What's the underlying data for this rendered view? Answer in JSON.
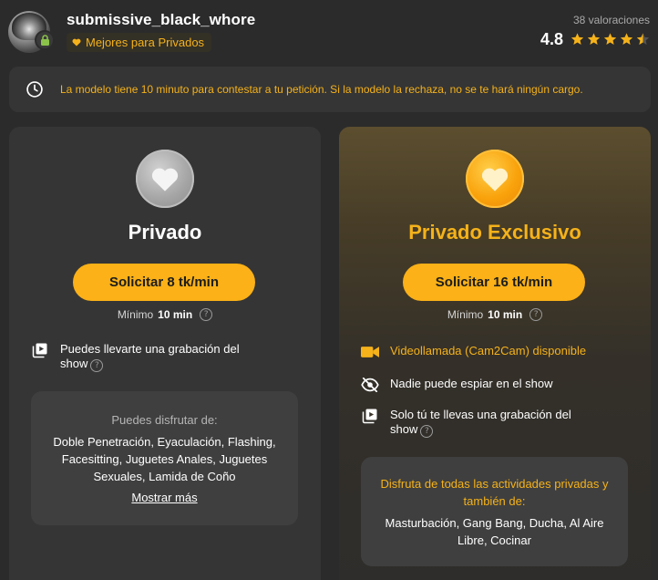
{
  "header": {
    "username": "submissive_black_whore",
    "tag_label": "Mejores para Privados",
    "rating_count": "38 valoraciones",
    "rating_value": "4.8",
    "stars_filled": 4.5
  },
  "notice": {
    "text": "La modelo tiene 10 minuto para contestar a tu petición. Si la modelo la rechaza, no se te hará ningún cargo."
  },
  "private": {
    "title": "Privado",
    "button_label": "Solicitar 8 tk/min",
    "minimo_label": "Mínimo",
    "minimo_value": "10 min",
    "feature_recording": "Puedes llevarte una grabación del show",
    "enjoy_title": "Puedes disfrutar de:",
    "enjoy_list": "Doble Penetración, Eyaculación, Flashing, Facesitting, Juguetes Anales, Juguetes Sexuales, Lamida de Coño",
    "show_more": "Mostrar más"
  },
  "exclusive": {
    "title": "Privado Exclusivo",
    "button_label": "Solicitar 16 tk/min",
    "minimo_label": "Mínimo",
    "minimo_value": "10 min",
    "feature_cam2cam": "Videollamada (Cam2Cam) disponible",
    "feature_nospy": "Nadie puede espiar en el show",
    "feature_recording": "Solo tú te llevas una grabación del show",
    "enjoy_title": "Disfruta de todas las actividades privadas y también de:",
    "enjoy_list": "Masturbación, Gang Bang, Ducha, Al Aire Libre, Cocinar"
  },
  "colors": {
    "accent": "#f5b21a",
    "button": "#fbb117",
    "background": "#2b2b2b",
    "card": "#353535"
  },
  "icons": [
    "lock-icon",
    "heart-small-icon",
    "star-icon",
    "clock-icon",
    "heart-icon",
    "help-icon",
    "video-recording-icon",
    "video-camera-icon",
    "eye-off-icon"
  ]
}
